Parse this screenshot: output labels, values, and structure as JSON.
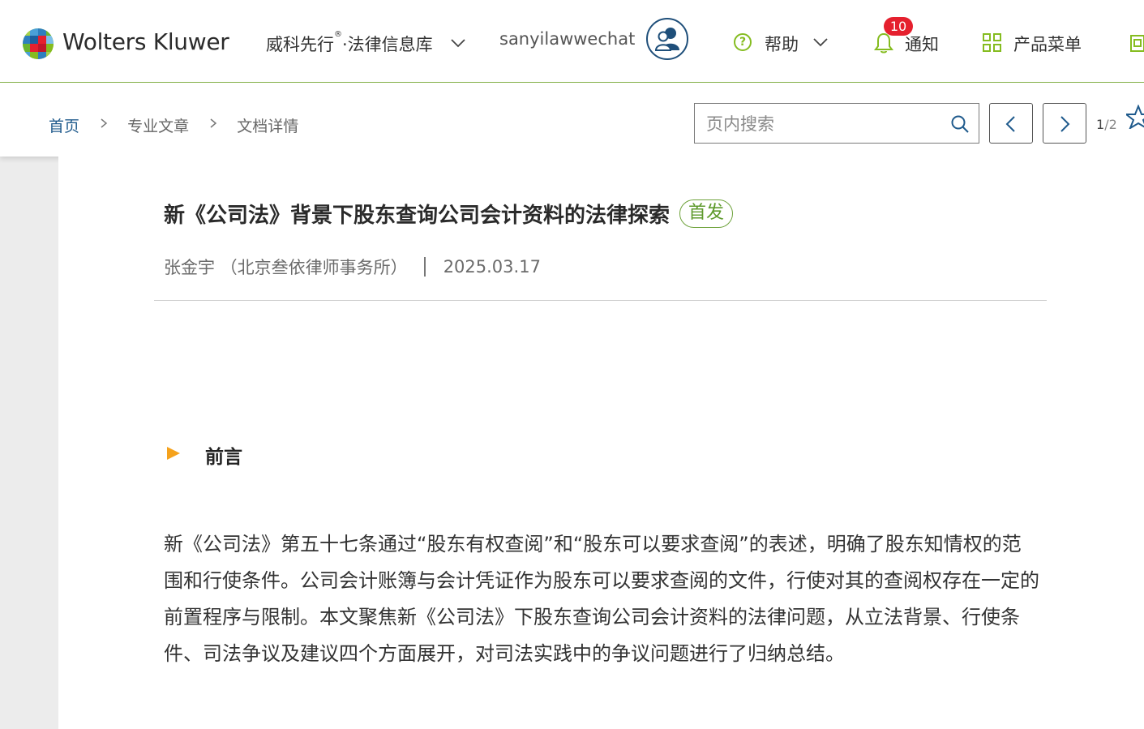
{
  "header": {
    "brand": "Wolters Kluwer",
    "product_name": "威科先行",
    "product_sup": "®",
    "product_suffix": "·法律信息库",
    "username": "sanyilawwechat",
    "help_label": "帮助",
    "notify_label": "通知",
    "notify_count": "10",
    "products_label": "产品菜单"
  },
  "breadcrumb": {
    "home": "首页",
    "section": "专业文章",
    "current": "文档详情"
  },
  "search": {
    "placeholder": "页内搜索",
    "value": ""
  },
  "pager": {
    "current": "1",
    "total": "/2"
  },
  "article": {
    "title": "新《公司法》背景下股东查询公司会计资料的法律探索",
    "tag": "首发",
    "author": "张金宇 （北京叁依律师事务所）",
    "date": "2025.03.17",
    "section_title": "前言",
    "paragraph": "新《公司法》第五十七条通过“股东有权查阅”和“股东可以要求查阅”的表述，明确了股东知情权的范围和行使条件。公司会计账簿与会计凭证作为股东可以要求查阅的文件，行使对其的查阅权存在一定的前置程序与限制。本文聚焦新《公司法》下股东查询公司会计资料的法律问题，从立法背景、行使条件、司法争议及建议四个方面展开，对司法实践中的争议问题进行了归纳总结。"
  },
  "colors": {
    "accent_green": "#85bc20",
    "link_blue": "#1f5a8c",
    "badge_red": "#e5202e",
    "section_arrow": "#f5a21c"
  },
  "icons": {
    "logo": "wolters-kluwer-logo",
    "avatar": "user-group-icon",
    "help": "question-circle-icon",
    "notify": "bell-icon",
    "products": "grid-icon",
    "search": "search-icon",
    "prev": "chevron-left-icon",
    "next": "chevron-right-icon",
    "favorite": "star-icon"
  }
}
